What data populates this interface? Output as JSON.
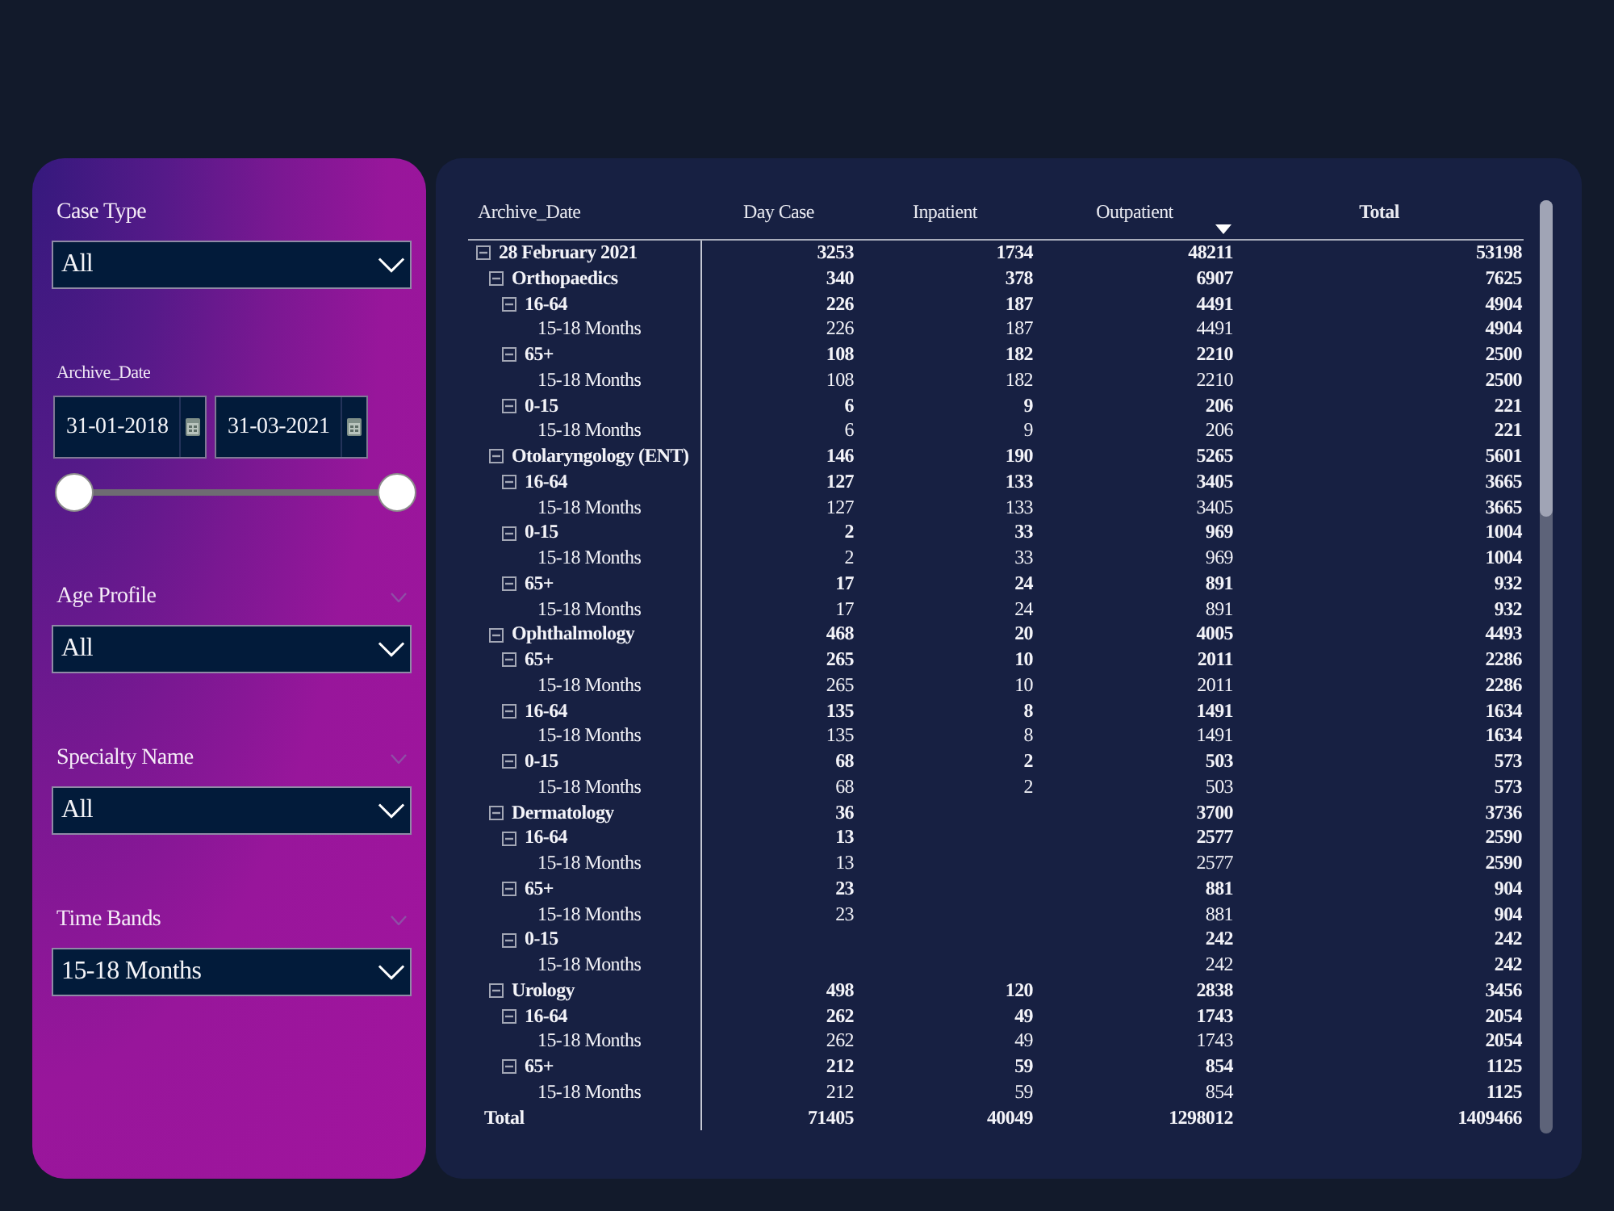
{
  "filter_panel": {
    "slicers": [
      {
        "kind": "dropdown",
        "title": "Case Type",
        "value": "All",
        "collapse_chevron": false
      },
      {
        "kind": "date_range",
        "title": "Archive_Date",
        "start": "31-01-2018",
        "end": "31-03-2021",
        "thumbs": [
          {
            "level": 0
          },
          {
            "level": 1
          }
        ]
      },
      {
        "kind": "dropdown",
        "title": "Age Profile",
        "value": "All",
        "collapse_chevron": true
      },
      {
        "kind": "dropdown",
        "title": "Specialty Name",
        "value": "All",
        "collapse_chevron": true
      },
      {
        "kind": "dropdown",
        "title": "Time Bands",
        "value": "15-18 Months",
        "collapse_chevron": true
      }
    ]
  },
  "matrix": {
    "row_header": "Archive_Date",
    "columns": [
      {
        "label": "Day Case",
        "kind": "measure",
        "sorted": false
      },
      {
        "label": "Inpatient",
        "kind": "measure",
        "sorted": false
      },
      {
        "label": "Outpatient",
        "kind": "measure",
        "sorted": true
      },
      {
        "label": "Total",
        "kind": "total",
        "sorted": false
      }
    ],
    "rows": [
      {
        "label": "28 February 2021",
        "expanded": true,
        "day_case": "3253",
        "inpatient": "1734",
        "outpatient": "48211",
        "total": "53198",
        "children": [
          {
            "label": "Orthopaedics",
            "expanded": true,
            "day_case": "340",
            "inpatient": "378",
            "outpatient": "6907",
            "total": "7625",
            "children": [
              {
                "label": "16-64",
                "expanded": true,
                "day_case": "226",
                "inpatient": "187",
                "outpatient": "4491",
                "total": "4904",
                "children": [
                  {
                    "label": "15-18 Months",
                    "day_case": "226",
                    "inpatient": "187",
                    "outpatient": "4491",
                    "total": "4904"
                  }
                ]
              },
              {
                "label": "65+",
                "expanded": true,
                "day_case": "108",
                "inpatient": "182",
                "outpatient": "2210",
                "total": "2500",
                "children": [
                  {
                    "label": "15-18 Months",
                    "day_case": "108",
                    "inpatient": "182",
                    "outpatient": "2210",
                    "total": "2500"
                  }
                ]
              },
              {
                "label": "0-15",
                "expanded": true,
                "day_case": "6",
                "inpatient": "9",
                "outpatient": "206",
                "total": "221",
                "children": [
                  {
                    "label": "15-18 Months",
                    "day_case": "6",
                    "inpatient": "9",
                    "outpatient": "206",
                    "total": "221"
                  }
                ]
              }
            ]
          },
          {
            "label": "Otolaryngology (ENT)",
            "expanded": true,
            "day_case": "146",
            "inpatient": "190",
            "outpatient": "5265",
            "total": "5601",
            "children": [
              {
                "label": "16-64",
                "expanded": true,
                "day_case": "127",
                "inpatient": "133",
                "outpatient": "3405",
                "total": "3665",
                "children": [
                  {
                    "label": "15-18 Months",
                    "day_case": "127",
                    "inpatient": "133",
                    "outpatient": "3405",
                    "total": "3665"
                  }
                ]
              },
              {
                "label": "0-15",
                "expanded": true,
                "day_case": "2",
                "inpatient": "33",
                "outpatient": "969",
                "total": "1004",
                "children": [
                  {
                    "label": "15-18 Months",
                    "day_case": "2",
                    "inpatient": "33",
                    "outpatient": "969",
                    "total": "1004"
                  }
                ]
              },
              {
                "label": "65+",
                "expanded": true,
                "day_case": "17",
                "inpatient": "24",
                "outpatient": "891",
                "total": "932",
                "children": [
                  {
                    "label": "15-18 Months",
                    "day_case": "17",
                    "inpatient": "24",
                    "outpatient": "891",
                    "total": "932"
                  }
                ]
              }
            ]
          },
          {
            "label": "Ophthalmology",
            "expanded": true,
            "day_case": "468",
            "inpatient": "20",
            "outpatient": "4005",
            "total": "4493",
            "children": [
              {
                "label": "65+",
                "expanded": true,
                "day_case": "265",
                "inpatient": "10",
                "outpatient": "2011",
                "total": "2286",
                "children": [
                  {
                    "label": "15-18 Months",
                    "day_case": "265",
                    "inpatient": "10",
                    "outpatient": "2011",
                    "total": "2286"
                  }
                ]
              },
              {
                "label": "16-64",
                "expanded": true,
                "day_case": "135",
                "inpatient": "8",
                "outpatient": "1491",
                "total": "1634",
                "children": [
                  {
                    "label": "15-18 Months",
                    "day_case": "135",
                    "inpatient": "8",
                    "outpatient": "1491",
                    "total": "1634"
                  }
                ]
              },
              {
                "label": "0-15",
                "expanded": true,
                "day_case": "68",
                "inpatient": "2",
                "outpatient": "503",
                "total": "573",
                "children": [
                  {
                    "label": "15-18 Months",
                    "day_case": "68",
                    "inpatient": "2",
                    "outpatient": "503",
                    "total": "573"
                  }
                ]
              }
            ]
          },
          {
            "label": "Dermatology",
            "expanded": true,
            "day_case": "36",
            "outpatient": "3700",
            "total": "3736",
            "children": [
              {
                "label": "16-64",
                "expanded": true,
                "day_case": "13",
                "outpatient": "2577",
                "total": "2590",
                "children": [
                  {
                    "label": "15-18 Months",
                    "day_case": "13",
                    "outpatient": "2577",
                    "total": "2590"
                  }
                ]
              },
              {
                "label": "65+",
                "expanded": true,
                "day_case": "23",
                "outpatient": "881",
                "total": "904",
                "children": [
                  {
                    "label": "15-18 Months",
                    "day_case": "23",
                    "outpatient": "881",
                    "total": "904"
                  }
                ]
              },
              {
                "label": "0-15",
                "expanded": true,
                "outpatient": "242",
                "total": "242",
                "children": [
                  {
                    "label": "15-18 Months",
                    "outpatient": "242",
                    "total": "242"
                  }
                ]
              }
            ]
          },
          {
            "label": "Urology",
            "expanded": true,
            "day_case": "498",
            "inpatient": "120",
            "outpatient": "2838",
            "total": "3456",
            "children": [
              {
                "label": "16-64",
                "expanded": true,
                "day_case": "262",
                "inpatient": "49",
                "outpatient": "1743",
                "total": "2054",
                "children": [
                  {
                    "label": "15-18 Months",
                    "day_case": "262",
                    "inpatient": "49",
                    "outpatient": "1743",
                    "total": "2054"
                  }
                ]
              },
              {
                "label": "65+",
                "expanded": true,
                "day_case": "212",
                "inpatient": "59",
                "outpatient": "854",
                "total": "1125",
                "children": [
                  {
                    "label": "15-18 Months",
                    "day_case": "212",
                    "inpatient": "59",
                    "outpatient": "854",
                    "total": "1125"
                  }
                ]
              }
            ]
          }
        ]
      }
    ],
    "total": {
      "label": "Total",
      "day_case": "71405",
      "inpatient": "40049",
      "outpatient": "1298012",
      "total": "1409466"
    }
  }
}
